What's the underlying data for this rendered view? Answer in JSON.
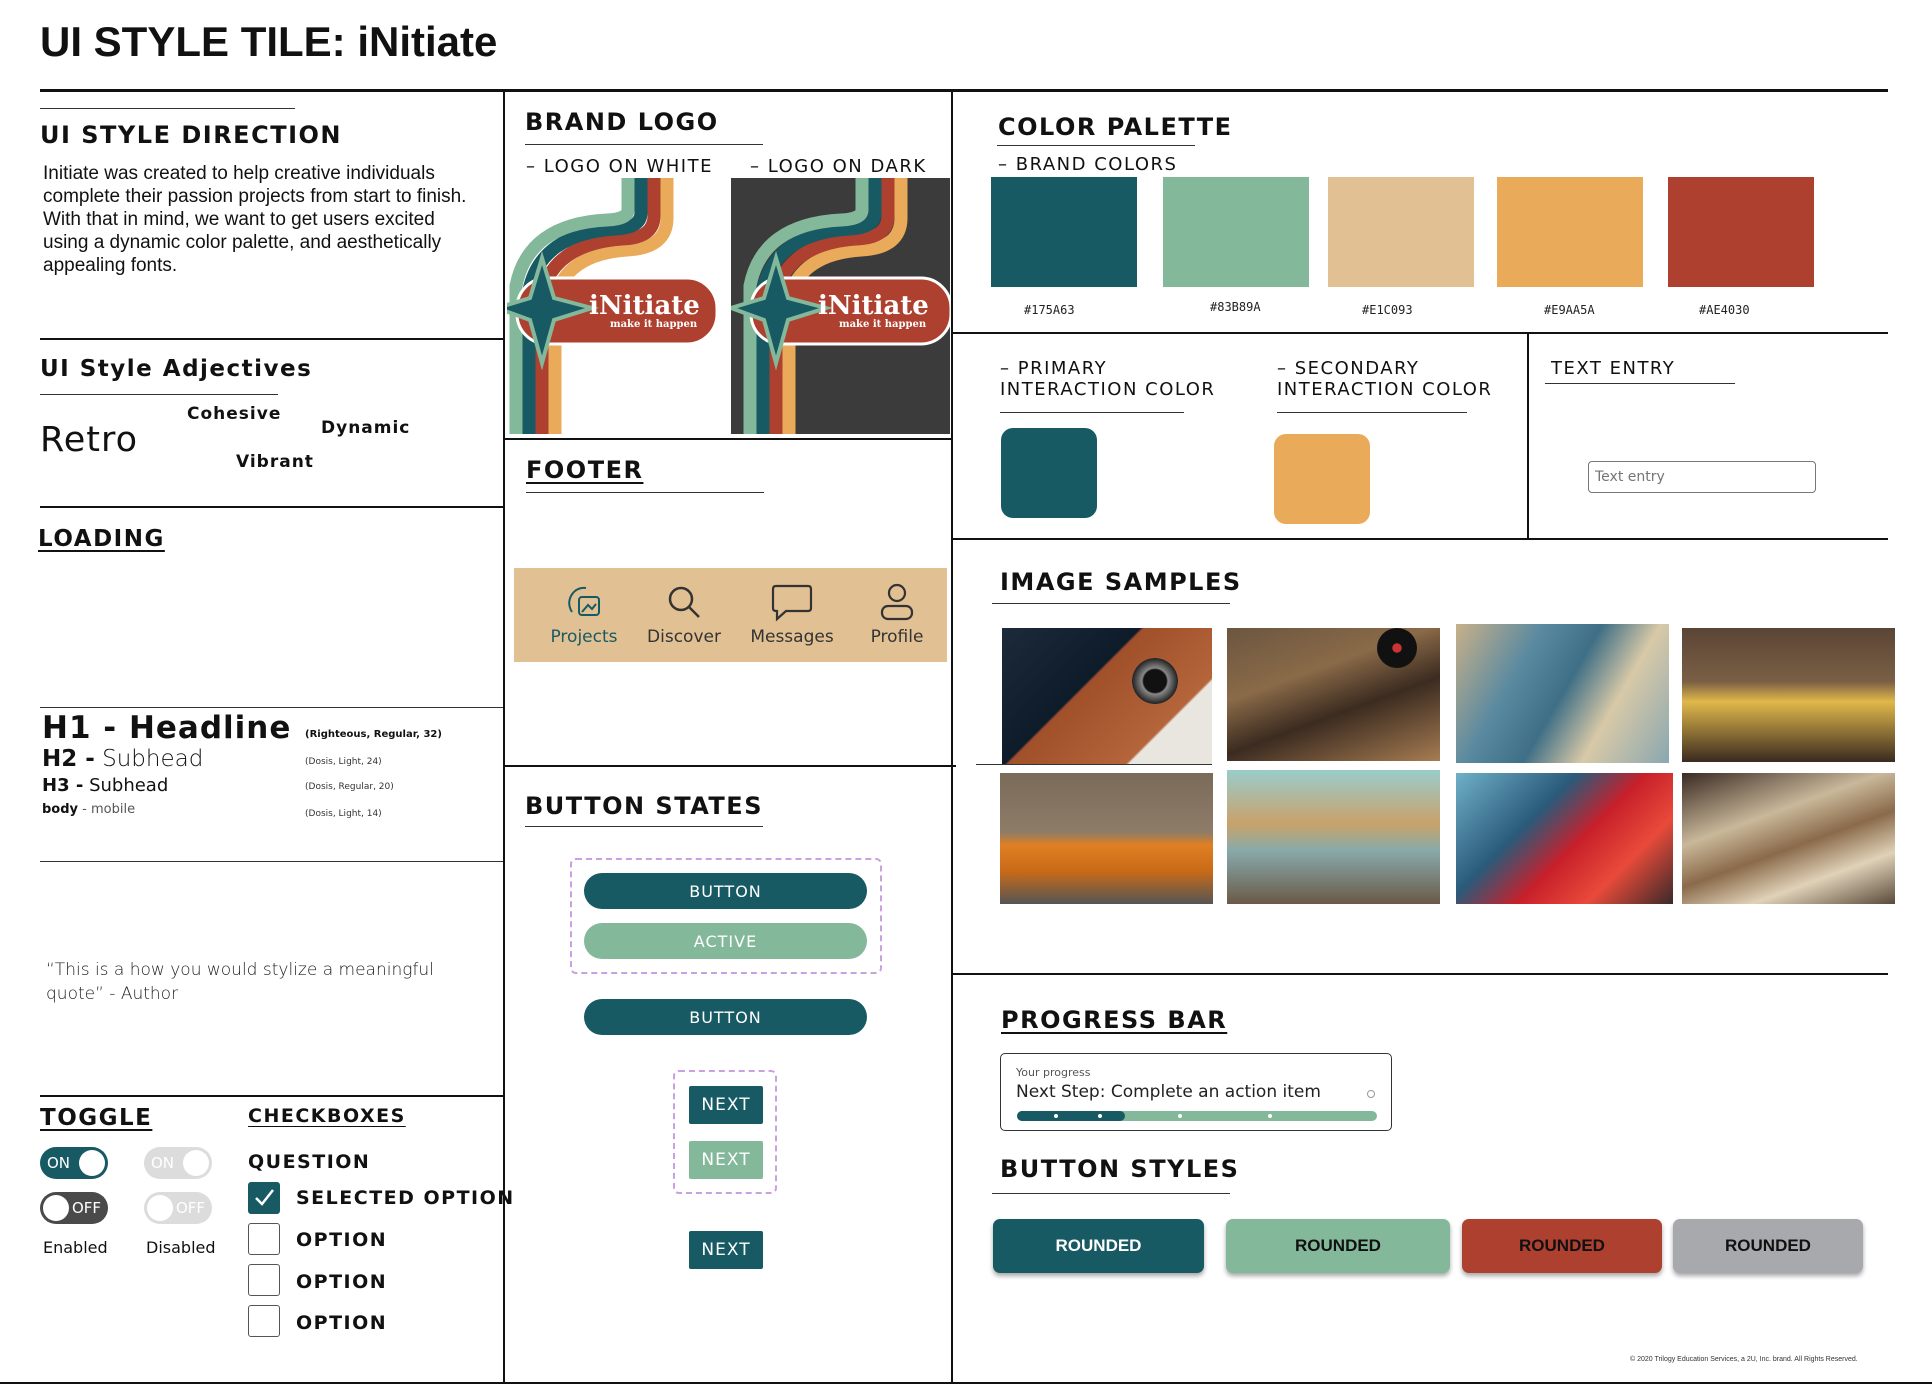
{
  "page_title": "UI STYLE TILE: iNitiate",
  "direction": {
    "title": "UI STYLE DIRECTION",
    "text": "Initiate was created to help creative individuals complete their passion projects from start to finish. With that in mind, we want to get users excited using a dynamic color palette, and aesthetically appealing fonts."
  },
  "adjectives": {
    "title": "UI Style Adjectives",
    "items": [
      "Retro",
      "Cohesive",
      "Dynamic",
      "Vibrant"
    ]
  },
  "loading": {
    "title": "LOADING"
  },
  "typography": {
    "h1": "H1 - Headline",
    "h1_spec": "(Righteous, Regular, 32)",
    "h2_prefix": "H2 -",
    "h2": "Subhead",
    "h2_spec": "(Dosis, Light, 24)",
    "h3_prefix": "H3 -",
    "h3": "Subhead",
    "h3_spec": "(Dosis, Regular, 20)",
    "body_prefix": "body",
    "body": "- mobile",
    "body_spec": "(Dosis, Light, 14)"
  },
  "quote": {
    "text": "“This is a how you would stylize a meaningful quote”  - Author"
  },
  "toggle": {
    "title": "TOGGLE",
    "on_label": "ON",
    "off_label": "OFF",
    "enabled_label": "Enabled",
    "disabled_label": "Disabled"
  },
  "checkboxes": {
    "title": "CHECKBOXES",
    "question": "QUESTION",
    "options": [
      "SELECTED OPTION",
      "OPTION",
      "OPTION",
      "OPTION"
    ]
  },
  "brand_logo": {
    "title": "BRAND LOGO",
    "on_white": "– LOGO ON WHITE",
    "on_dark": "– LOGO ON DARK",
    "wordmark": "iNitiate",
    "tagline": "make it happen"
  },
  "footer": {
    "title": "FOOTER",
    "nav": [
      "Projects",
      "Discover",
      "Messages",
      "Profile"
    ]
  },
  "button_states": {
    "title": "BUTTON STATES",
    "button": "BUTTON",
    "active": "ACTIVE",
    "button2": "BUTTON",
    "next": "NEXT",
    "next_active": "NEXT",
    "next2": "NEXT"
  },
  "palette": {
    "title": "COLOR PALETTE",
    "subtitle": "– BRAND COLORS",
    "colors": [
      "#175A63",
      "#83B89A",
      "#E1C093",
      "#E9AA5A",
      "#AE4030"
    ]
  },
  "interaction": {
    "primary_line1": "– PRIMARY",
    "primary_line2": "INTERACTION COLOR",
    "secondary_line1": "– SECONDARY",
    "secondary_line2": "INTERACTION COLOR",
    "primary_color": "#175A63",
    "secondary_color": "#E9AA5A"
  },
  "text_entry": {
    "title": "TEXT ENTRY",
    "placeholder": "Text entry"
  },
  "image_samples": {
    "title": "IMAGE SAMPLES"
  },
  "progress": {
    "title": "PROGRESS BAR",
    "label": "Your progress",
    "step": "Next Step: Complete an action item",
    "value": 0.3
  },
  "button_styles": {
    "title": "BUTTON STYLES",
    "buttons": [
      "ROUNDED",
      "ROUNDED",
      "ROUNDED",
      "ROUNDED"
    ],
    "colors": [
      "#175A63",
      "#83B89A",
      "#AE4030",
      "#A7A9AC"
    ]
  },
  "copyright": "© 2020 Trilogy Education Services, a 2U, Inc. brand. All Rights Reserved."
}
